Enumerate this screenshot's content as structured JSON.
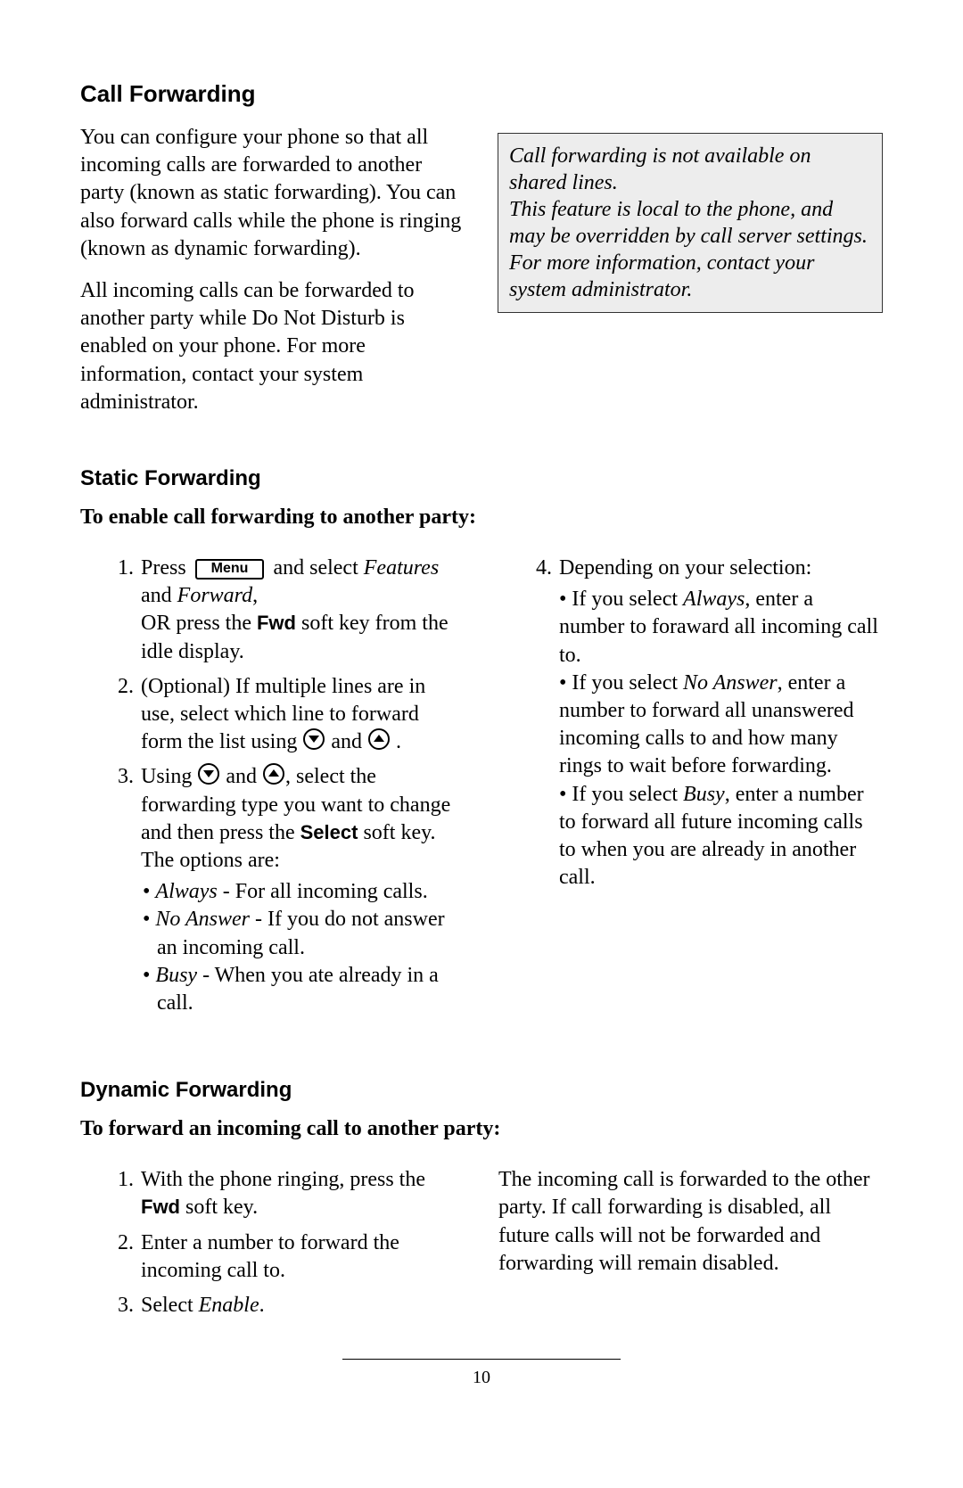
{
  "page_number": "10",
  "section_heading": "Call Forwarding",
  "intro": {
    "p1": "You can configure your phone so that all incoming calls are forwarded to another party (known as static forwarding). You can also forward calls while the phone is ringing (known as dynamic forwarding).",
    "p2": "All incoming calls can be forwarded to another party while Do Not Disturb is enabled on your phone. For more information, contact your system administrator."
  },
  "note": {
    "l1": "Call forwarding is not available on shared lines.",
    "l2": "This feature is local to the phone, and may be overridden by call server settings.",
    "l3": "For more information, contact your system administrator."
  },
  "static": {
    "heading": "Static Forwarding",
    "lead": "To enable call forwarding to another party:",
    "keys": {
      "menu_label": "Menu",
      "fwd_label": "Fwd",
      "select_label": "Select"
    },
    "step1_a": "Press ",
    "step1_b": " and select ",
    "step1_features": "Features",
    "step1_c": " and ",
    "step1_forward": "Forward",
    "step1_d": ",",
    "step1_e": "OR press the ",
    "step1_f": " soft key from the idle display.",
    "step2": "(Optional) If multiple lines are in use, select which line to forward form the list using ",
    "step2_and": " and ",
    "step2_end": " .",
    "step3_a": "Using ",
    "step3_b": " and ",
    "step3_c": ", select the forwarding type you want to change and then press the ",
    "step3_d": " soft key. The options are:",
    "opt_always": "Always",
    "opt_always_txt": " - For all incoming calls.",
    "opt_noanswer": "No Answer",
    "opt_noanswer_txt": " - If you do not answer an incoming call.",
    "opt_busy": "Busy",
    "opt_busy_txt": " - When you ate already in a call.",
    "step4": "Depending on your selection:",
    "dep_always_a": "If you select ",
    "dep_always_b": ", enter a number to foraward all incoming call to.",
    "dep_noanswer_a": "If you select ",
    "dep_noanswer_b": " enter a number to forward all unanswered incoming calls to and how many rings to wait before forwarding.",
    "dep_busy_a": "If you select ",
    "dep_busy_b": " enter a number to forward all future incoming calls to when you are already in another call."
  },
  "dynamic": {
    "heading": "Dynamic Forwarding",
    "lead": "To forward an incoming call to another party:",
    "step1_a": "With the phone ringing, press  the ",
    "step1_b": " soft key.",
    "step2": "Enter a number to forward the incoming call to.",
    "step3_a": "Select ",
    "step3_enable": "Enable",
    "step3_b": ".",
    "right": "The incoming call is forwarded to the other party. If call forwarding is disabled, all future calls will not be forwarded and forwarding will remain disabled."
  }
}
